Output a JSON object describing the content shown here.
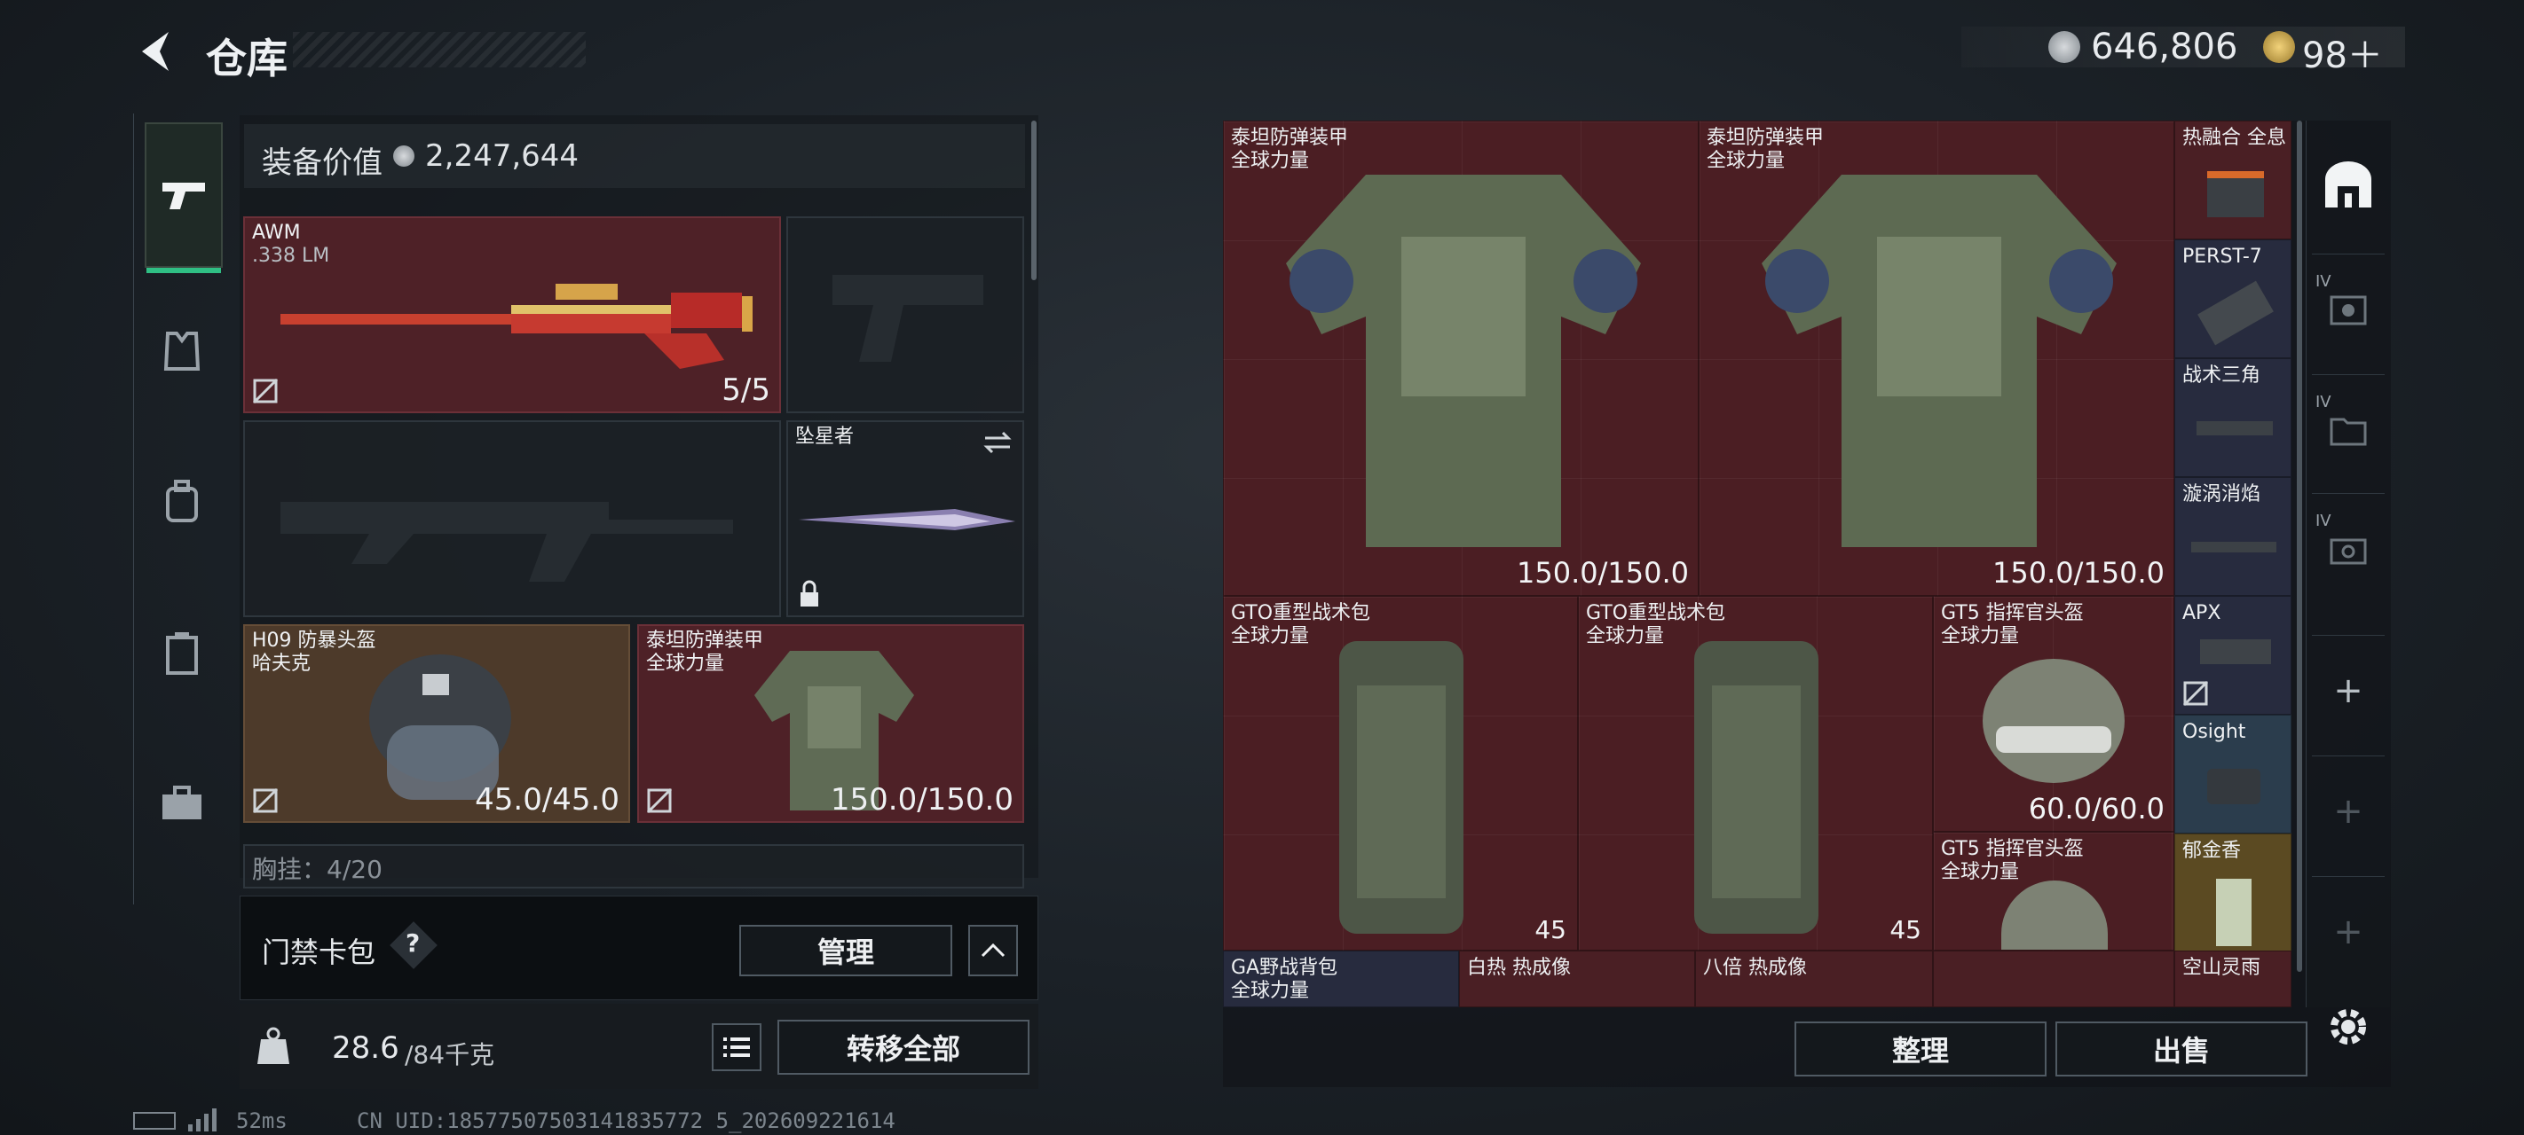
{
  "header": {
    "title": "仓库",
    "back_icon": "back-arrow-icon"
  },
  "currency": {
    "coins": "646,806",
    "tokens": "98＋"
  },
  "loadout": {
    "value_label": "装备价值",
    "value": "2,247,644",
    "primary": {
      "name": "AWM",
      "caliber": ".338 LM",
      "ammo": "5/5"
    },
    "melee": {
      "name": "坠星者"
    },
    "helmet": {
      "name": "H09 防暴头盔",
      "brand": "哈夫克",
      "durability": "45.0/45.0"
    },
    "armor": {
      "name": "泰坦防弹装甲",
      "brand": "全球力量",
      "durability": "150.0/150.0"
    },
    "chest_rig_partial": "胸挂：4/20"
  },
  "card_pack": {
    "label": "门禁卡包",
    "help": "?",
    "manage_label": "管理"
  },
  "weight": {
    "current": "28.6",
    "max": "/84千克"
  },
  "transfer_all_label": "转移全部",
  "stash": {
    "items": [
      {
        "id": "armor1",
        "name": "泰坦防弹装甲",
        "brand": "全球力量",
        "value": "150.0/150.0"
      },
      {
        "id": "armor2",
        "name": "泰坦防弹装甲",
        "brand": "全球力量",
        "value": "150.0/150.0"
      },
      {
        "id": "fusion",
        "name": "热融合 全息"
      },
      {
        "id": "perst",
        "name": "PERST-7"
      },
      {
        "id": "tri",
        "name": "战术三角"
      },
      {
        "id": "vortex",
        "name": "漩涡消焰"
      },
      {
        "id": "bag1",
        "name": "GTO重型战术包",
        "brand": "全球力量",
        "count": "45"
      },
      {
        "id": "bag2",
        "name": "GTO重型战术包",
        "brand": "全球力量",
        "count": "45"
      },
      {
        "id": "helm1",
        "name": "GT5 指挥官头盔",
        "brand": "全球力量",
        "value": "60.0/60.0"
      },
      {
        "id": "helm2",
        "name": "GT5 指挥官头盔",
        "brand": "全球力量"
      },
      {
        "id": "apx",
        "name": "APX"
      },
      {
        "id": "osight",
        "name": "Osight"
      },
      {
        "id": "tulip",
        "name": "郁金香"
      },
      {
        "id": "ga",
        "name": "GA野战背包",
        "brand": "全球力量"
      },
      {
        "id": "thermal",
        "name": "白热 热成像"
      },
      {
        "id": "x8",
        "name": "八倍 热成像"
      },
      {
        "id": "rain",
        "name": "空山灵雨"
      }
    ]
  },
  "actions": {
    "sort_label": "整理",
    "sell_label": "出售"
  },
  "side_tabs": {
    "tier": "IV",
    "add": "+"
  },
  "status": {
    "ping": "52ms",
    "uid": "CN UID:18577507503141835772 5_202609221614"
  },
  "colors": {
    "accent_green": "#2fbf84",
    "slot_red": "#4b1e23"
  }
}
